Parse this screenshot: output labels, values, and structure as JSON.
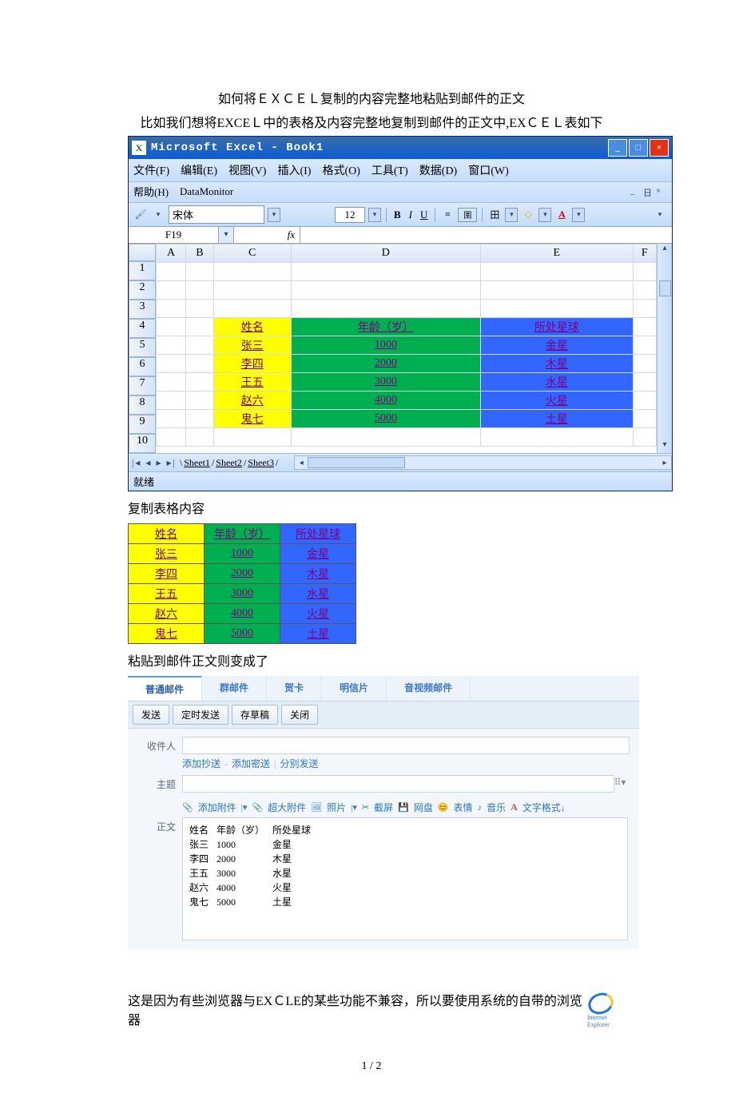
{
  "doc": {
    "title": "如何将ＥＸＣＥＬ复制的内容完整地粘贴到邮件的正文",
    "subtitle": "比如我们想将EXCEＬ中的表格及内容完整地复制到邮件的正文中,EXＣＥＬ表如下",
    "copy_caption": "复制表格内容",
    "paste_caption": "粘贴到邮件正文则变成了",
    "footer_text": "这是因为有些浏览器与EXＣLE的某些功能不兼容，所以要使用系统的自带的浏览器",
    "page_num": "1 / 2"
  },
  "excel": {
    "title": "Microsoft Excel - Book1",
    "menu": {
      "file": "文件(F)",
      "edit": "编辑(E)",
      "view": "视图(V)",
      "insert": "插入(I)",
      "format": "格式(O)",
      "tools": "工具(T)",
      "data": "数据(D)",
      "window": "窗口(W)",
      "help": "帮助(H)",
      "datamon": "DataMonitor"
    },
    "font": "宋体",
    "size": "12",
    "namebox": "F19",
    "fx": "fx",
    "cols": {
      "A": "A",
      "B": "B",
      "C": "C",
      "D": "D",
      "E": "E",
      "F": "F"
    },
    "rows": {
      "1": "1",
      "2": "2",
      "3": "3",
      "4": "4",
      "5": "5",
      "6": "6",
      "7": "7",
      "8": "8",
      "9": "9",
      "10": "10"
    },
    "sheets": {
      "s1": "Sheet1",
      "s2": "Sheet2",
      "s3": "Sheet3"
    },
    "status": "就绪",
    "header": {
      "name": "姓名",
      "age": "年龄（岁）",
      "planet": "所处星球"
    },
    "data_rows": [
      {
        "name": "张三",
        "age": "1000",
        "planet": "金星"
      },
      {
        "name": "李四",
        "age": "2000",
        "planet": "木星"
      },
      {
        "name": "王五",
        "age": "3000",
        "planet": "水星"
      },
      {
        "name": "赵六",
        "age": "4000",
        "planet": "火星"
      },
      {
        "name": "鬼七",
        "age": "5000",
        "planet": "土星"
      }
    ]
  },
  "mail": {
    "tabs": {
      "normal": "普通邮件",
      "group": "群邮件",
      "card": "贺卡",
      "postcard": "明信片",
      "av": "音视频邮件"
    },
    "btns": {
      "send": "发送",
      "timed": "定时发送",
      "draft": "存草稿",
      "close": "关闭"
    },
    "labels": {
      "to": "收件人",
      "subj": "主题",
      "body": "正文"
    },
    "links": {
      "cc": "添加抄送",
      "bcc": "添加密送",
      "sep": "分别发送"
    },
    "tool": {
      "attach": "添加附件",
      "big": "超大附件",
      "photo": "照片",
      "shot": "截屏",
      "disk": "网盘",
      "emoji": "表情",
      "music": "音乐",
      "fmt": "文字格式↓"
    }
  },
  "ie": {
    "label": "Internet Explorer"
  }
}
